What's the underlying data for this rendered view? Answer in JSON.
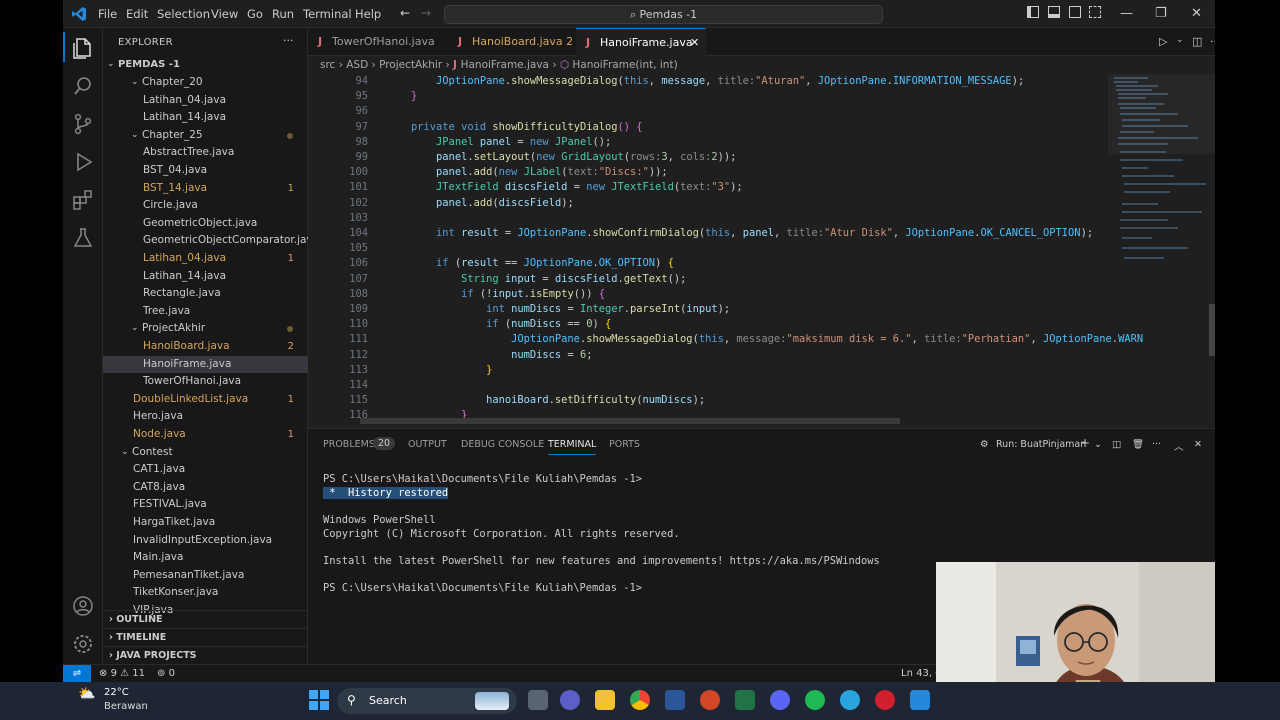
{
  "title_bar": {
    "menu": [
      "File",
      "Edit",
      "Selection",
      "View",
      "Go",
      "Run",
      "Terminal",
      "Help"
    ],
    "search_text": "Pemdas -1",
    "colors": {
      "vscode_blue": "#2489db",
      "accent": "#0078d4"
    }
  },
  "explorer": {
    "header": "EXPLORER",
    "root": "PEMDAS -1",
    "items": [
      {
        "label": "Chapter_20",
        "type": "folder"
      },
      {
        "label": "Latihan_04.java"
      },
      {
        "label": "Latihan_14.java"
      },
      {
        "label": "Chapter_25",
        "type": "folder"
      },
      {
        "label": "AbstractTree.java"
      },
      {
        "label": "BST_04.java"
      },
      {
        "label": "BST_14.java",
        "count": "1"
      },
      {
        "label": "Circle.java"
      },
      {
        "label": "GeometricObject.java"
      },
      {
        "label": "GeometricObjectComparator.java"
      },
      {
        "label": "Latihan_04.java",
        "count": "1"
      },
      {
        "label": "Latihan_14.java"
      },
      {
        "label": "Rectangle.java"
      },
      {
        "label": "Tree.java"
      },
      {
        "label": "ProjectAkhir",
        "type": "folder"
      },
      {
        "label": "HanoiBoard.java",
        "count": "2"
      },
      {
        "label": "HanoiFrame.java"
      },
      {
        "label": "TowerOfHanoi.java"
      },
      {
        "label": "DoubleLinkedList.java",
        "count": "1"
      },
      {
        "label": "Hero.java"
      },
      {
        "label": "Node.java",
        "count": "1"
      },
      {
        "label": "Contest",
        "type": "folder"
      },
      {
        "label": "CAT1.java"
      },
      {
        "label": "CAT8.java"
      },
      {
        "label": "FESTIVAL.java"
      },
      {
        "label": "HargaTiket.java"
      },
      {
        "label": "InvalidInputException.java"
      },
      {
        "label": "Main.java"
      },
      {
        "label": "PemesananTiket.java"
      },
      {
        "label": "TiketKonser.java"
      },
      {
        "label": "VIP.java"
      }
    ],
    "sections": [
      "OUTLINE",
      "TIMELINE",
      "JAVA PROJECTS"
    ]
  },
  "tabs": [
    {
      "label": "TowerOfHanoi.java"
    },
    {
      "label": "HanoiBoard.java 2"
    },
    {
      "label": "HanoiFrame.java",
      "active": true
    }
  ],
  "breadcrumbs": [
    "src",
    "ASD",
    "ProjectAkhir",
    "HanoiFrame.java",
    "HanoiFrame(int, int)"
  ],
  "code": {
    "line_numbers": [
      "94",
      "95",
      "96",
      "97",
      "98",
      "99",
      "100",
      "101",
      "102",
      "103",
      "104",
      "105",
      "106",
      "107",
      "108",
      "109",
      "110",
      "111",
      "112",
      "113",
      "114",
      "115",
      "116"
    ]
  },
  "panel": {
    "tabs": [
      "PROBLEMS",
      "20",
      "OUTPUT",
      "DEBUG CONSOLE",
      "TERMINAL",
      "PORTS"
    ],
    "run_label": "Run: BuatPinjaman",
    "terminal_lines": [
      "PS C:\\Users\\Haikal\\Documents\\File Kuliah\\Pemdas -1>",
      "History restored",
      "Windows PowerShell",
      "Copyright (C) Microsoft Corporation. All rights reserved.",
      "Install the latest PowerShell for new features and improvements! https://aka.ms/PSWindows",
      "PS C:\\Users\\Haikal\\Documents\\File Kuliah\\Pemdas -1>"
    ]
  },
  "status": {
    "errors": "9",
    "warnings": "11",
    "ports": "0",
    "position": "Ln 43, C"
  },
  "taskbar": {
    "temp": "22°C",
    "weather": "Berawan",
    "search": "Search"
  }
}
